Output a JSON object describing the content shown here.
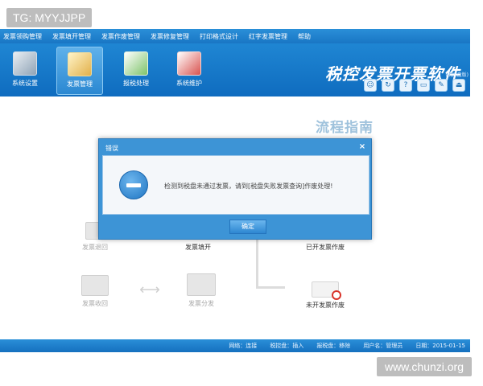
{
  "watermarks": {
    "top_left": "TG: MYYJJPP",
    "bottom_right": "www.chunzi.org"
  },
  "menubar": {
    "items": [
      "发票领购管理",
      "发票填开管理",
      "发票作废管理",
      "发票修复管理",
      "打印格式设计",
      "红字发票管理",
      "帮助"
    ]
  },
  "toolbar": {
    "items": [
      {
        "label": "系统设置",
        "icon": "settings-icon"
      },
      {
        "label": "发票管理",
        "icon": "invoice-icon"
      },
      {
        "label": "报税处理",
        "icon": "tax-icon"
      },
      {
        "label": "系统维护",
        "icon": "maintenance-icon"
      }
    ],
    "active_index": 1,
    "brand": "税控发票开票软件",
    "brand_sub": "(税控盘版)"
  },
  "quick_icons": [
    "user-icon",
    "refresh-icon",
    "help-icon",
    "window-icon",
    "edit-icon",
    "exit-icon"
  ],
  "guide": {
    "title": "流程指南",
    "nodes": {
      "return": "发票退回",
      "fill": "发票填开",
      "voided_issued": "已开发票作废",
      "recover": "发票收回",
      "distribute": "发票分发",
      "voided_unissued": "未开发票作废"
    }
  },
  "status": {
    "network": "网络：连接",
    "tax_disk": "税控盘：插入",
    "report_disk": "报税盘：移除",
    "user": "用户名：管理员",
    "date": "日期：2015-01-15"
  },
  "dialog": {
    "title": "错误",
    "close": "×",
    "message": "检测到税盘未通过发票，请到[税盘失败发票查询]作废处理!",
    "ok_label": "确定"
  },
  "colors": {
    "primary_blue": "#1976c4",
    "dialog_blue": "#3d94d6",
    "guide_title": "#9fc2dc"
  }
}
